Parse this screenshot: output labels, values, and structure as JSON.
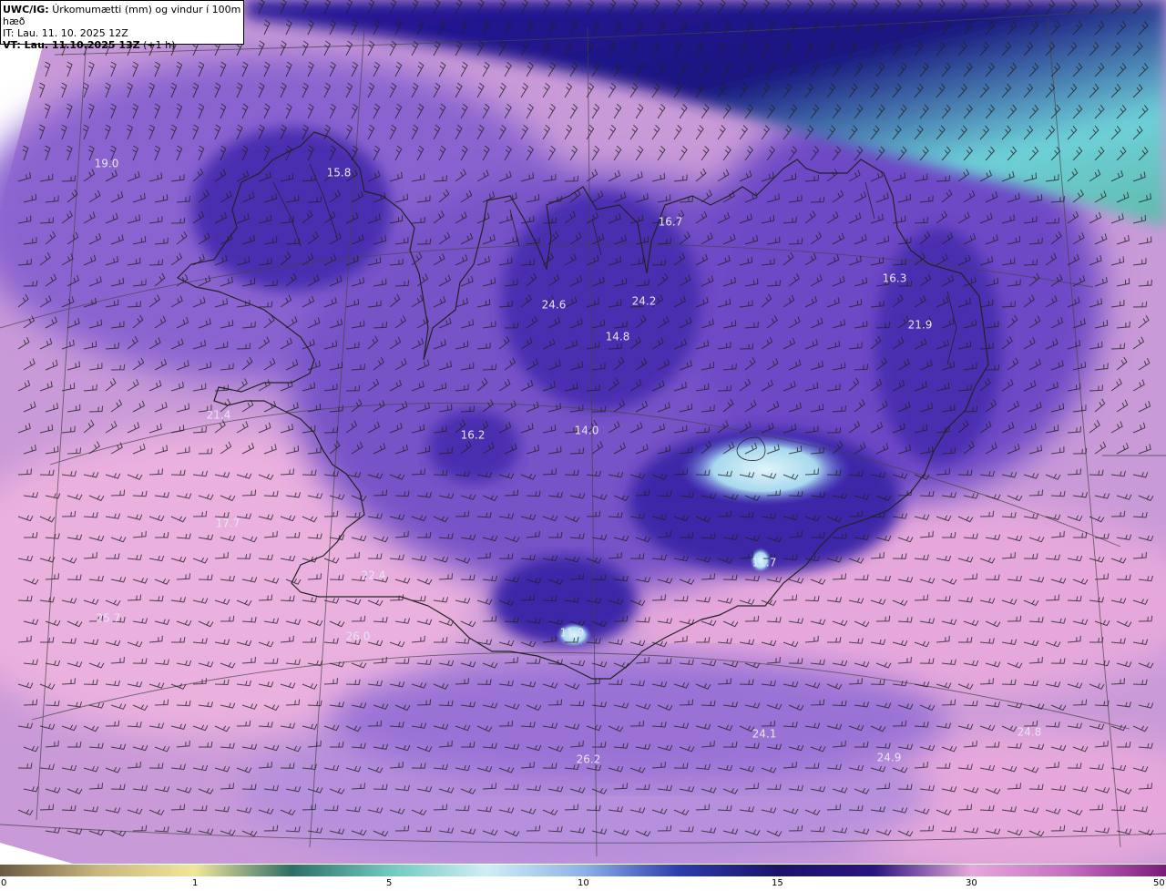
{
  "header": {
    "model_code": "UWC/IG:",
    "title": "Úrkomumætti (mm) og vindur í 100m hæð",
    "init_time": "IT: Lau. 11. 10. 2025 12Z",
    "valid_time_bold": "VT: Lau. 11.10.2025 13Z",
    "valid_time_offset": "(+1 h)"
  },
  "map": {
    "value_labels": [
      "19.0",
      "15.8",
      "16.7",
      "16.3",
      "21.9",
      "24.6",
      "24.2",
      "14.8",
      "14.0",
      "16.2",
      "21.4",
      "17.7",
      "11.7",
      "22.4",
      "25.7",
      "26.0",
      "11.9",
      "24.1",
      "24.8",
      "24.9",
      "26.2"
    ],
    "colors": {
      "ocean_pink": "#e6a8dc",
      "violet": "#9a6fd6",
      "deep_purple": "#4a2fb0",
      "navy": "#1a1880",
      "ice_blue": "#b8e6f2",
      "teal": "#6fc7bf",
      "coastline": "#222222"
    }
  },
  "colorbar": {
    "ticks": [
      "0",
      "1",
      "5",
      "10",
      "15",
      "30",
      "50"
    ],
    "colors": [
      "#6b5a45",
      "#c9b57e",
      "#f0e79a",
      "#2f6e66",
      "#6fc7bf",
      "#cfeef4",
      "#8fb2e8",
      "#2b3ca8",
      "#1a1469",
      "#2a1480",
      "#e6a8dc",
      "#c26fc0",
      "#7a1a7a"
    ]
  }
}
